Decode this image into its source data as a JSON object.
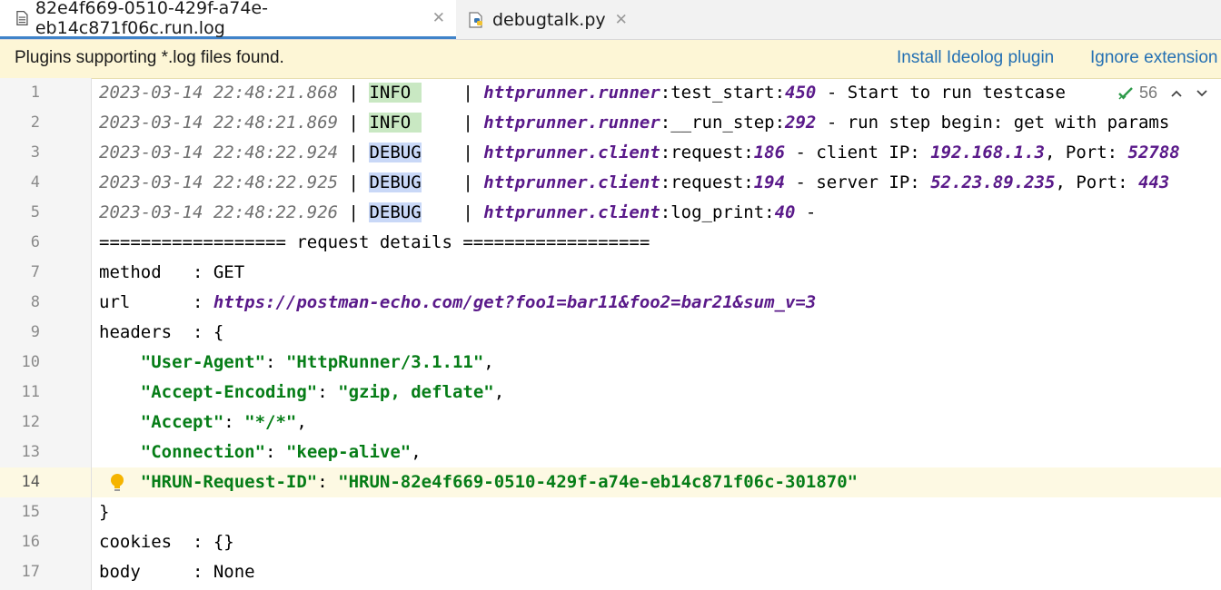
{
  "tabs": [
    {
      "label": "82e4f669-0510-429f-a74e-eb14c871f06c.run.log",
      "close": "✕"
    },
    {
      "label": "debugtalk.py",
      "close": "✕"
    }
  ],
  "banner": {
    "message": "Plugins supporting *.log files found.",
    "install_link": "Install Ideolog plugin",
    "ignore_link": "Ignore extension"
  },
  "inspection": {
    "count": "56"
  },
  "lines": [
    {
      "n": "1",
      "ts": "2023-03-14 22:48:21.868",
      "level": "INFO",
      "levelpad": " ",
      "logger": "httprunner.runner",
      "func": ":test_start:",
      "lineno": "450",
      "rest": " - Start to run testcase"
    },
    {
      "n": "2",
      "ts": "2023-03-14 22:48:21.869",
      "level": "INFO",
      "levelpad": " ",
      "logger": "httprunner.runner",
      "func": ":__run_step:",
      "lineno": "292",
      "rest": " - run step begin: get with params"
    },
    {
      "n": "3",
      "ts": "2023-03-14 22:48:22.924",
      "level": "DEBUG",
      "levelpad": "",
      "logger": "httprunner.client",
      "func": ":request:",
      "lineno": "186",
      "rest": " - client IP: ",
      "ip": "192.168.1.3",
      "rest2": ", Port: ",
      "port": "52788"
    },
    {
      "n": "4",
      "ts": "2023-03-14 22:48:22.925",
      "level": "DEBUG",
      "levelpad": "",
      "logger": "httprunner.client",
      "func": ":request:",
      "lineno": "194",
      "rest": " - server IP: ",
      "ip": "52.23.89.235",
      "rest2": ", Port: ",
      "port": "443"
    },
    {
      "n": "5",
      "ts": "2023-03-14 22:48:22.926",
      "level": "DEBUG",
      "levelpad": "",
      "logger": "httprunner.client",
      "func": ":log_print:",
      "lineno": "40",
      "rest": " -"
    },
    {
      "n": "6",
      "text": "================== request details =================="
    },
    {
      "n": "7",
      "key": "method   : ",
      "val": "GET"
    },
    {
      "n": "8",
      "key": "url      : ",
      "url": "https://postman-echo.com/get?foo1=bar11&foo2=bar21&sum_v=3"
    },
    {
      "n": "9",
      "text": "headers  : {"
    },
    {
      "n": "10",
      "hk": "\"User-Agent\"",
      "hv": "\"HttpRunner/3.1.11\"",
      "tail": ","
    },
    {
      "n": "11",
      "hk": "\"Accept-Encoding\"",
      "hv": "\"gzip, deflate\"",
      "tail": ","
    },
    {
      "n": "12",
      "hk": "\"Accept\"",
      "hv": "\"*/*\"",
      "tail": ","
    },
    {
      "n": "13",
      "hk": "\"Connection\"",
      "hv": "\"keep-alive\"",
      "tail": ","
    },
    {
      "n": "14",
      "hk": "\"HRUN-Request-ID\"",
      "hv": "\"HRUN-82e4f669-0510-429f-a74e-eb14c871f06c-301870\"",
      "tail": ""
    },
    {
      "n": "15",
      "text": "}"
    },
    {
      "n": "16",
      "key": "cookies  : ",
      "val": "{}"
    },
    {
      "n": "17",
      "key": "body     : ",
      "val": "None"
    }
  ],
  "colors": {
    "accent": "#4083c9",
    "banner_bg": "#fdf6d6",
    "info_bg": "#c9e8c3",
    "debug_bg": "#c9d8f7",
    "logger": "#5a1a8a",
    "string": "#067d17",
    "current_line": "#fdf9e3"
  },
  "icons": [
    "log-file-icon",
    "python-file-icon",
    "lightbulb-icon",
    "inspection-ok-icon",
    "chevron-up-icon",
    "chevron-down-icon"
  ]
}
